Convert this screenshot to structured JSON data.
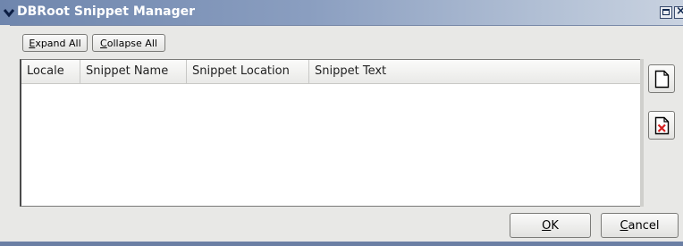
{
  "window": {
    "title": "DBRoot Snippet Manager"
  },
  "toolbar": {
    "expand_all_prefix": "E",
    "expand_all_rest": "xpand All",
    "collapse_all_prefix": "C",
    "collapse_all_rest": "ollapse All"
  },
  "table": {
    "columns": [
      "Locale",
      "Snippet Name",
      "Snippet Location",
      "Snippet Text"
    ],
    "rows": []
  },
  "side_buttons": {
    "new_icon": "new-document-icon",
    "delete_icon": "delete-document-icon"
  },
  "dialog_buttons": {
    "ok_prefix": "O",
    "ok_rest": "K",
    "cancel_prefix": "C",
    "cancel_rest": "ancel"
  },
  "colors": {
    "titlebar": "#6f86ad",
    "window_bg": "#e8e8e6",
    "delete_red": "#d42020"
  }
}
